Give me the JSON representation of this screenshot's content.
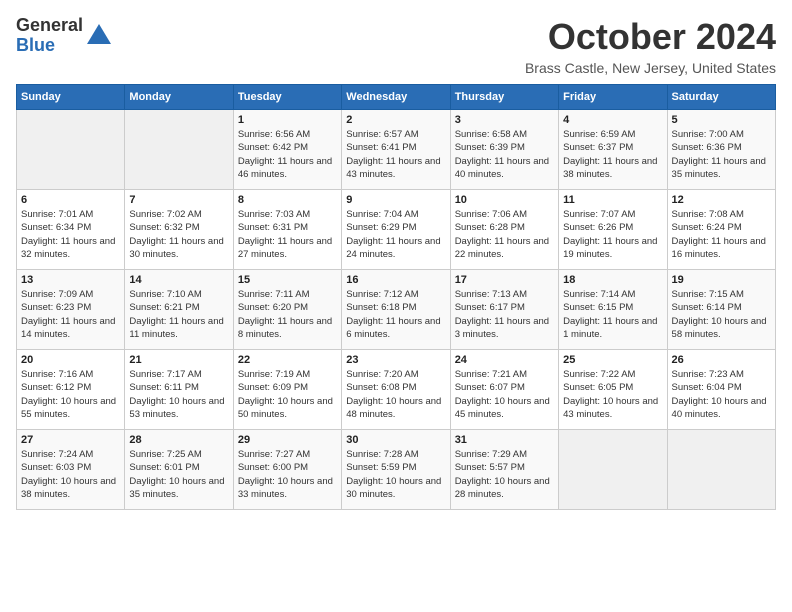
{
  "logo": {
    "general": "General",
    "blue": "Blue"
  },
  "title": "October 2024",
  "location": "Brass Castle, New Jersey, United States",
  "days_of_week": [
    "Sunday",
    "Monday",
    "Tuesday",
    "Wednesday",
    "Thursday",
    "Friday",
    "Saturday"
  ],
  "weeks": [
    [
      {
        "num": "",
        "sunrise": "",
        "sunset": "",
        "daylight": ""
      },
      {
        "num": "",
        "sunrise": "",
        "sunset": "",
        "daylight": ""
      },
      {
        "num": "1",
        "sunrise": "Sunrise: 6:56 AM",
        "sunset": "Sunset: 6:42 PM",
        "daylight": "Daylight: 11 hours and 46 minutes."
      },
      {
        "num": "2",
        "sunrise": "Sunrise: 6:57 AM",
        "sunset": "Sunset: 6:41 PM",
        "daylight": "Daylight: 11 hours and 43 minutes."
      },
      {
        "num": "3",
        "sunrise": "Sunrise: 6:58 AM",
        "sunset": "Sunset: 6:39 PM",
        "daylight": "Daylight: 11 hours and 40 minutes."
      },
      {
        "num": "4",
        "sunrise": "Sunrise: 6:59 AM",
        "sunset": "Sunset: 6:37 PM",
        "daylight": "Daylight: 11 hours and 38 minutes."
      },
      {
        "num": "5",
        "sunrise": "Sunrise: 7:00 AM",
        "sunset": "Sunset: 6:36 PM",
        "daylight": "Daylight: 11 hours and 35 minutes."
      }
    ],
    [
      {
        "num": "6",
        "sunrise": "Sunrise: 7:01 AM",
        "sunset": "Sunset: 6:34 PM",
        "daylight": "Daylight: 11 hours and 32 minutes."
      },
      {
        "num": "7",
        "sunrise": "Sunrise: 7:02 AM",
        "sunset": "Sunset: 6:32 PM",
        "daylight": "Daylight: 11 hours and 30 minutes."
      },
      {
        "num": "8",
        "sunrise": "Sunrise: 7:03 AM",
        "sunset": "Sunset: 6:31 PM",
        "daylight": "Daylight: 11 hours and 27 minutes."
      },
      {
        "num": "9",
        "sunrise": "Sunrise: 7:04 AM",
        "sunset": "Sunset: 6:29 PM",
        "daylight": "Daylight: 11 hours and 24 minutes."
      },
      {
        "num": "10",
        "sunrise": "Sunrise: 7:06 AM",
        "sunset": "Sunset: 6:28 PM",
        "daylight": "Daylight: 11 hours and 22 minutes."
      },
      {
        "num": "11",
        "sunrise": "Sunrise: 7:07 AM",
        "sunset": "Sunset: 6:26 PM",
        "daylight": "Daylight: 11 hours and 19 minutes."
      },
      {
        "num": "12",
        "sunrise": "Sunrise: 7:08 AM",
        "sunset": "Sunset: 6:24 PM",
        "daylight": "Daylight: 11 hours and 16 minutes."
      }
    ],
    [
      {
        "num": "13",
        "sunrise": "Sunrise: 7:09 AM",
        "sunset": "Sunset: 6:23 PM",
        "daylight": "Daylight: 11 hours and 14 minutes."
      },
      {
        "num": "14",
        "sunrise": "Sunrise: 7:10 AM",
        "sunset": "Sunset: 6:21 PM",
        "daylight": "Daylight: 11 hours and 11 minutes."
      },
      {
        "num": "15",
        "sunrise": "Sunrise: 7:11 AM",
        "sunset": "Sunset: 6:20 PM",
        "daylight": "Daylight: 11 hours and 8 minutes."
      },
      {
        "num": "16",
        "sunrise": "Sunrise: 7:12 AM",
        "sunset": "Sunset: 6:18 PM",
        "daylight": "Daylight: 11 hours and 6 minutes."
      },
      {
        "num": "17",
        "sunrise": "Sunrise: 7:13 AM",
        "sunset": "Sunset: 6:17 PM",
        "daylight": "Daylight: 11 hours and 3 minutes."
      },
      {
        "num": "18",
        "sunrise": "Sunrise: 7:14 AM",
        "sunset": "Sunset: 6:15 PM",
        "daylight": "Daylight: 11 hours and 1 minute."
      },
      {
        "num": "19",
        "sunrise": "Sunrise: 7:15 AM",
        "sunset": "Sunset: 6:14 PM",
        "daylight": "Daylight: 10 hours and 58 minutes."
      }
    ],
    [
      {
        "num": "20",
        "sunrise": "Sunrise: 7:16 AM",
        "sunset": "Sunset: 6:12 PM",
        "daylight": "Daylight: 10 hours and 55 minutes."
      },
      {
        "num": "21",
        "sunrise": "Sunrise: 7:17 AM",
        "sunset": "Sunset: 6:11 PM",
        "daylight": "Daylight: 10 hours and 53 minutes."
      },
      {
        "num": "22",
        "sunrise": "Sunrise: 7:19 AM",
        "sunset": "Sunset: 6:09 PM",
        "daylight": "Daylight: 10 hours and 50 minutes."
      },
      {
        "num": "23",
        "sunrise": "Sunrise: 7:20 AM",
        "sunset": "Sunset: 6:08 PM",
        "daylight": "Daylight: 10 hours and 48 minutes."
      },
      {
        "num": "24",
        "sunrise": "Sunrise: 7:21 AM",
        "sunset": "Sunset: 6:07 PM",
        "daylight": "Daylight: 10 hours and 45 minutes."
      },
      {
        "num": "25",
        "sunrise": "Sunrise: 7:22 AM",
        "sunset": "Sunset: 6:05 PM",
        "daylight": "Daylight: 10 hours and 43 minutes."
      },
      {
        "num": "26",
        "sunrise": "Sunrise: 7:23 AM",
        "sunset": "Sunset: 6:04 PM",
        "daylight": "Daylight: 10 hours and 40 minutes."
      }
    ],
    [
      {
        "num": "27",
        "sunrise": "Sunrise: 7:24 AM",
        "sunset": "Sunset: 6:03 PM",
        "daylight": "Daylight: 10 hours and 38 minutes."
      },
      {
        "num": "28",
        "sunrise": "Sunrise: 7:25 AM",
        "sunset": "Sunset: 6:01 PM",
        "daylight": "Daylight: 10 hours and 35 minutes."
      },
      {
        "num": "29",
        "sunrise": "Sunrise: 7:27 AM",
        "sunset": "Sunset: 6:00 PM",
        "daylight": "Daylight: 10 hours and 33 minutes."
      },
      {
        "num": "30",
        "sunrise": "Sunrise: 7:28 AM",
        "sunset": "Sunset: 5:59 PM",
        "daylight": "Daylight: 10 hours and 30 minutes."
      },
      {
        "num": "31",
        "sunrise": "Sunrise: 7:29 AM",
        "sunset": "Sunset: 5:57 PM",
        "daylight": "Daylight: 10 hours and 28 minutes."
      },
      {
        "num": "",
        "sunrise": "",
        "sunset": "",
        "daylight": ""
      },
      {
        "num": "",
        "sunrise": "",
        "sunset": "",
        "daylight": ""
      }
    ]
  ]
}
